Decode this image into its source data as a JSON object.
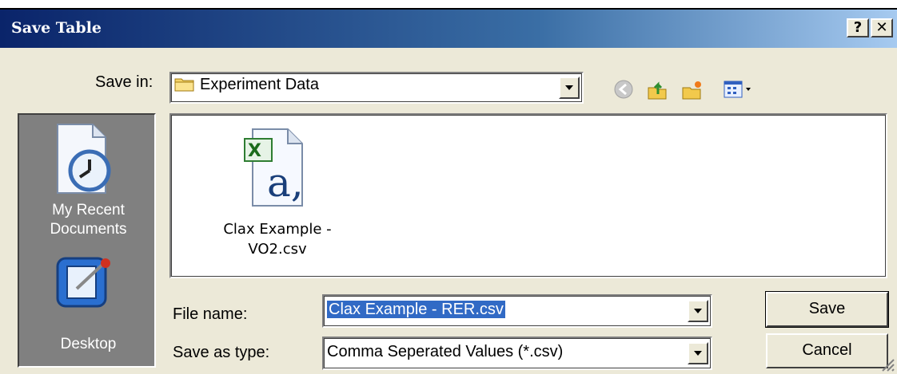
{
  "window": {
    "title": "Save Table",
    "help_label": "?",
    "close_label": "✕"
  },
  "save_in": {
    "label": "Save in:",
    "value": "Experiment Data"
  },
  "toolbar": {
    "icons": [
      "back-icon",
      "up-folder-icon",
      "new-folder-icon",
      "view-menu-icon"
    ]
  },
  "places": [
    {
      "label_line1": "My Recent",
      "label_line2": "Documents",
      "icon": "recent-documents-icon"
    },
    {
      "label_line1": "Desktop",
      "icon": "desktop-icon"
    }
  ],
  "files": [
    {
      "name_line1": "Clax Example -",
      "name_line2": "VO2.csv",
      "icon": "excel-csv-icon"
    }
  ],
  "file_name": {
    "label": "File name:",
    "value": "Clax Example - RER.csv"
  },
  "save_as_type": {
    "label": "Save as type:",
    "value": "Comma Seperated Values (*.csv)"
  },
  "buttons": {
    "save": "Save",
    "cancel": "Cancel"
  }
}
